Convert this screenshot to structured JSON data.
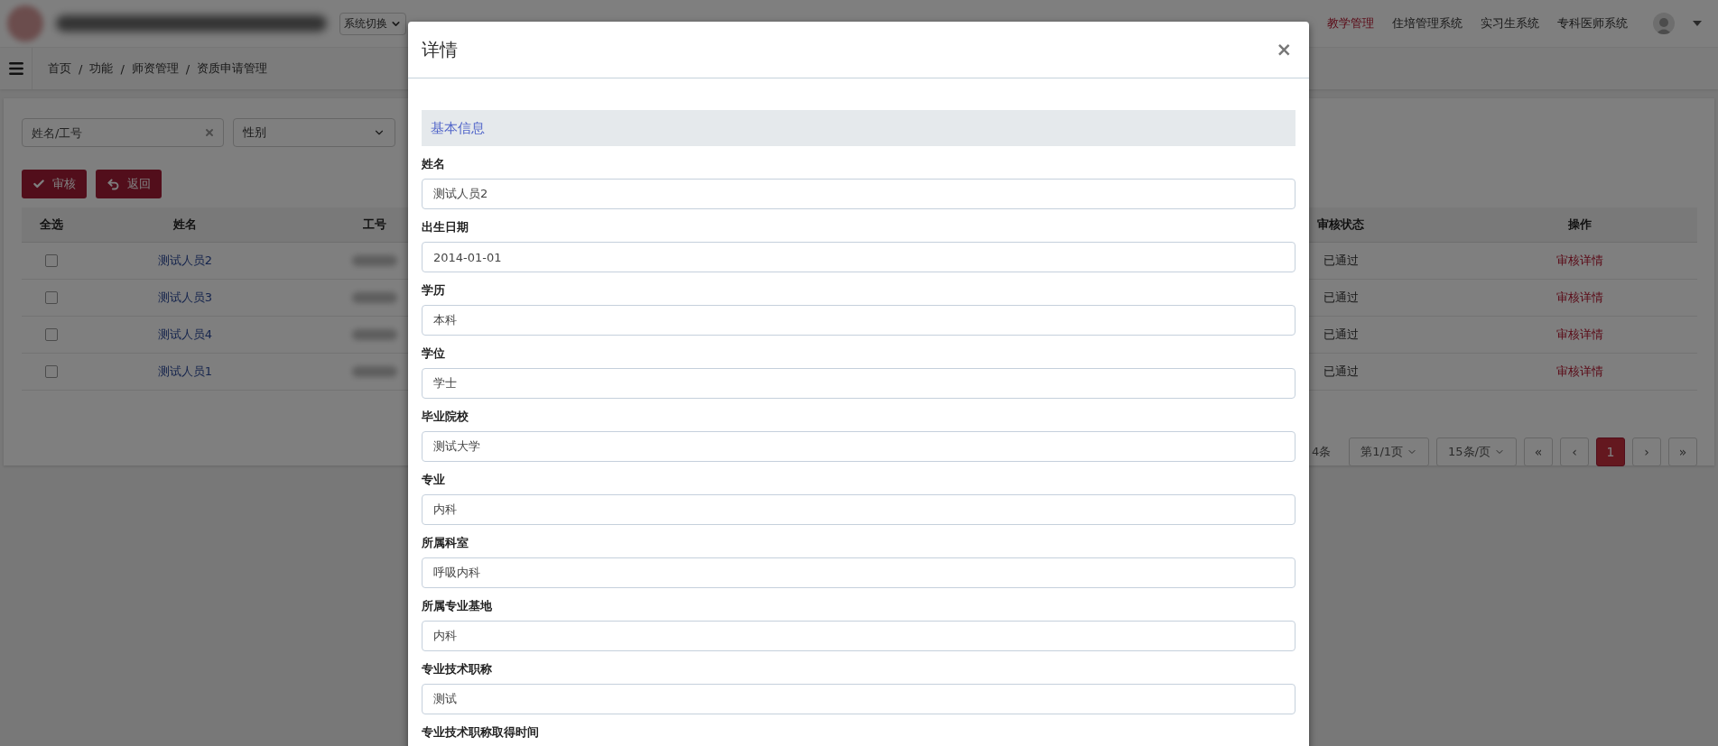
{
  "header": {
    "system_switch": "系统切换",
    "nav": [
      {
        "label": "教学管理",
        "selected": true
      },
      {
        "label": "住培管理系统",
        "selected": false
      },
      {
        "label": "实习生系统",
        "selected": false
      },
      {
        "label": "专科医师系统",
        "selected": false
      }
    ]
  },
  "breadcrumb": {
    "separator": "/",
    "items": [
      "首页",
      "功能",
      "师资管理",
      "资质申请管理"
    ]
  },
  "filters": {
    "name_field": {
      "placeholder": "姓名/工号"
    },
    "gender_select": {
      "value": "性别"
    }
  },
  "actions": [
    {
      "label": "审核",
      "kind": "check"
    },
    {
      "label": "返回",
      "kind": "back"
    }
  ],
  "table": {
    "columns": {
      "select_all": "全选",
      "name": "姓名",
      "staff_no": "工号",
      "status": "审核状态",
      "operation": "操作"
    },
    "rows": [
      {
        "checked": false,
        "name": "测试人员2",
        "status": "已通过",
        "action": "审核详情"
      },
      {
        "checked": false,
        "name": "测试人员3",
        "status": "已通过",
        "action": "审核详情"
      },
      {
        "checked": false,
        "name": "测试人员4",
        "status": "已通过",
        "action": "审核详情"
      },
      {
        "checked": false,
        "name": "测试人员1",
        "status": "已通过",
        "action": "审核详情"
      }
    ]
  },
  "pagination": {
    "total": "4条",
    "page_select": "第1/1页",
    "size_select": "15条/页",
    "buttons": [
      {
        "label": "«",
        "selected": false
      },
      {
        "label": "‹",
        "selected": false
      },
      {
        "label": "1",
        "selected": true
      },
      {
        "label": "›",
        "selected": false
      },
      {
        "label": "»",
        "selected": false
      }
    ]
  },
  "modal": {
    "title": "详情",
    "close": "×",
    "section": "基本信息",
    "fields": [
      {
        "label": "姓名",
        "value": "测试人员2"
      },
      {
        "label": "出生日期",
        "value": "2014-01-01"
      },
      {
        "label": "学历",
        "value": "本科"
      },
      {
        "label": "学位",
        "value": "学士"
      },
      {
        "label": "毕业院校",
        "value": "测试大学"
      },
      {
        "label": "专业",
        "value": "内科"
      },
      {
        "label": "所属科室",
        "value": "呼吸内科"
      },
      {
        "label": "所属专业基地",
        "value": "内科"
      },
      {
        "label": "专业技术职称",
        "value": "测试"
      },
      {
        "label": "专业技术职称取得时间"
      }
    ]
  }
}
